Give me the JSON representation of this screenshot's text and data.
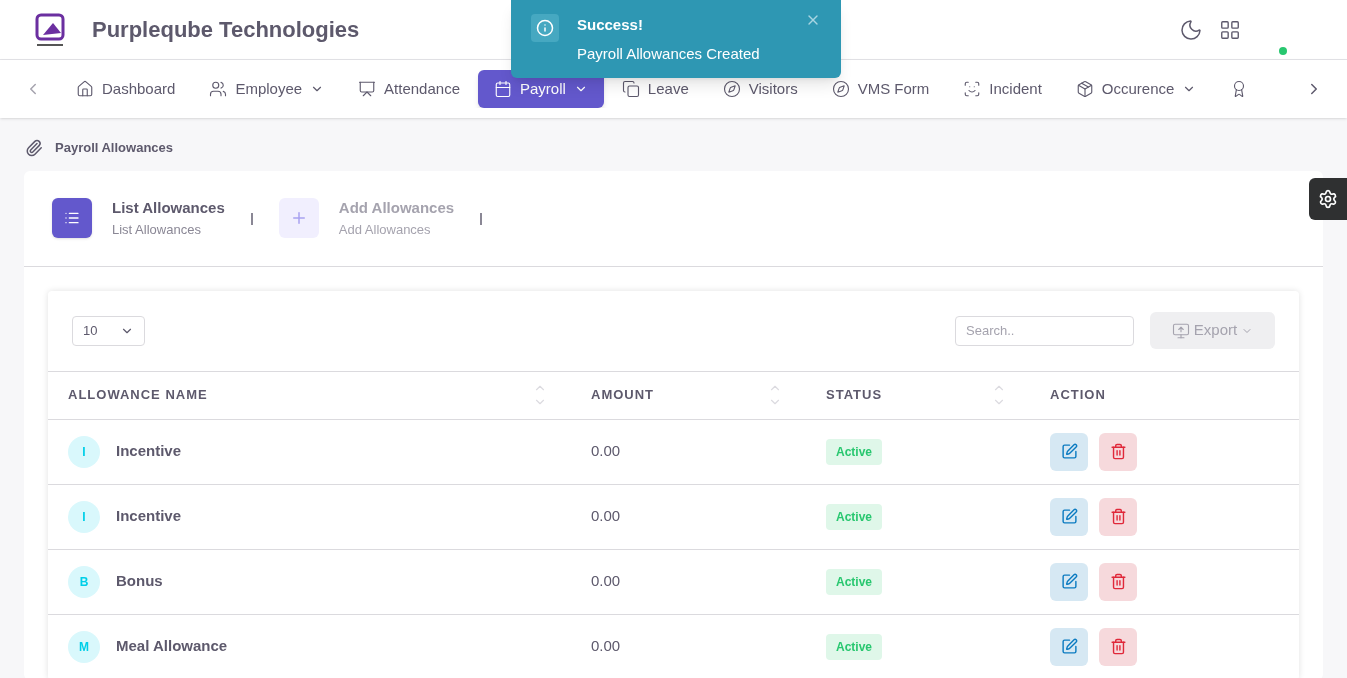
{
  "header": {
    "company": "Purpleqube Technologies",
    "online": true
  },
  "nav": {
    "items": [
      {
        "kind": "home",
        "label": "Dashboard",
        "dropdown": false,
        "selected": false
      },
      {
        "kind": "users",
        "label": "Employee",
        "dropdown": true,
        "selected": false
      },
      {
        "kind": "monitor",
        "label": "Attendance",
        "dropdown": false,
        "selected": false
      },
      {
        "kind": "calendar",
        "label": "Payroll",
        "dropdown": true,
        "selected": true
      },
      {
        "kind": "copy",
        "label": "Leave",
        "dropdown": false,
        "selected": false
      },
      {
        "kind": "compass",
        "label": "Visitors",
        "dropdown": false,
        "selected": false
      },
      {
        "kind": "compass",
        "label": "VMS Form",
        "dropdown": false,
        "selected": false
      },
      {
        "kind": "scan",
        "label": "Incident",
        "dropdown": false,
        "selected": false
      },
      {
        "kind": "box",
        "label": "Occurence",
        "dropdown": true,
        "selected": false
      },
      {
        "kind": "award",
        "dropdown": false,
        "selected": false
      }
    ]
  },
  "toast": {
    "title": "Success!",
    "message": "Payroll Allowances Created"
  },
  "breadcrumb": "Payroll Allowances",
  "tabs": [
    {
      "kind": "list",
      "title": "List Allowances",
      "subtitle": "List Allowances",
      "selected": true
    },
    {
      "kind": "plus",
      "title": "Add Allowances",
      "subtitle": "Add Allowances",
      "selected": false
    }
  ],
  "table": {
    "page_size": "10",
    "search": {
      "placeholder": "Search.."
    },
    "export": "Export",
    "columns": [
      {
        "label": "ALLOWANCE NAME",
        "sortable": true
      },
      {
        "label": "AMOUNT",
        "sortable": true
      },
      {
        "label": "STATUS",
        "sortable": true
      },
      {
        "label": "ACTION",
        "sortable": false
      }
    ],
    "rows": [
      {
        "initial": "I",
        "name": "Incentive",
        "amount": "0.00",
        "status": "Active"
      },
      {
        "initial": "I",
        "name": "Incentive",
        "amount": "0.00",
        "status": "Active"
      },
      {
        "initial": "B",
        "name": "Bonus",
        "amount": "0.00",
        "status": "Active"
      },
      {
        "initial": "M",
        "name": "Meal Allowance",
        "amount": "0.00",
        "status": "Active"
      }
    ]
  }
}
